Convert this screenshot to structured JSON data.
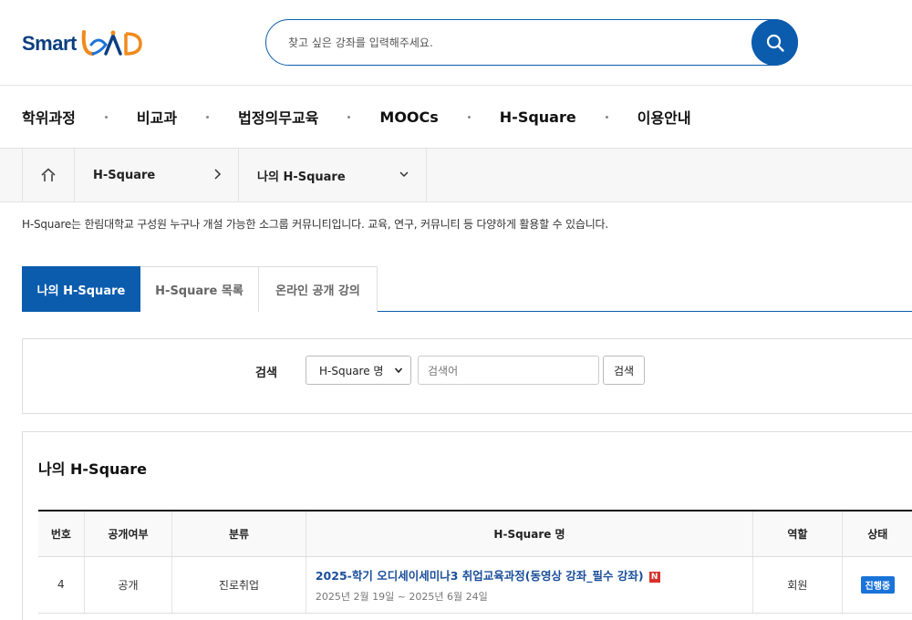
{
  "logo": {
    "smart": "Smart",
    "lead": "LEAD"
  },
  "search": {
    "placeholder": "찾고 싶은 강좌를 입력해주세요."
  },
  "gnb": [
    "학위과정",
    "비교과",
    "법정의무교육",
    "MOOCs",
    "H-Square",
    "이용안내"
  ],
  "breadcrumb": {
    "level1": "H-Square",
    "level2": "나의 H-Square"
  },
  "description": "H-Square는 한림대학교 구성원 누구나 개설 가능한 소그룹 커뮤니티입니다. 교육, 연구, 커뮤니티 등 다양하게 활용할 수 있습니다.",
  "tabs": [
    "나의 H-Square",
    "H-Square 목록",
    "온라인 공개 강의"
  ],
  "filter": {
    "label": "검색",
    "select_value": "H-Square 명",
    "input_placeholder": "검색어",
    "button": "검색"
  },
  "list": {
    "title": "나의 H-Square",
    "headers": [
      "번호",
      "공개여부",
      "분류",
      "H-Square 명",
      "역할",
      "상태"
    ],
    "rows": [
      {
        "no": "4",
        "visibility": "공개",
        "category": "진로취업",
        "name": "2025-학기 오디세이세미나3 취업교육과정(동영상 강좌_필수 강좌)",
        "new_badge": "N",
        "period": "2025년 2월 19일 ~ 2025년 6월 24일",
        "role": "회원",
        "status": "진행중"
      }
    ]
  },
  "colors": {
    "primary": "#0b5cad",
    "logo_blue": "#0b3f80",
    "logo_orange": "#f08a1c",
    "new_badge": "#d9322d",
    "status_badge": "#1a73d9"
  }
}
